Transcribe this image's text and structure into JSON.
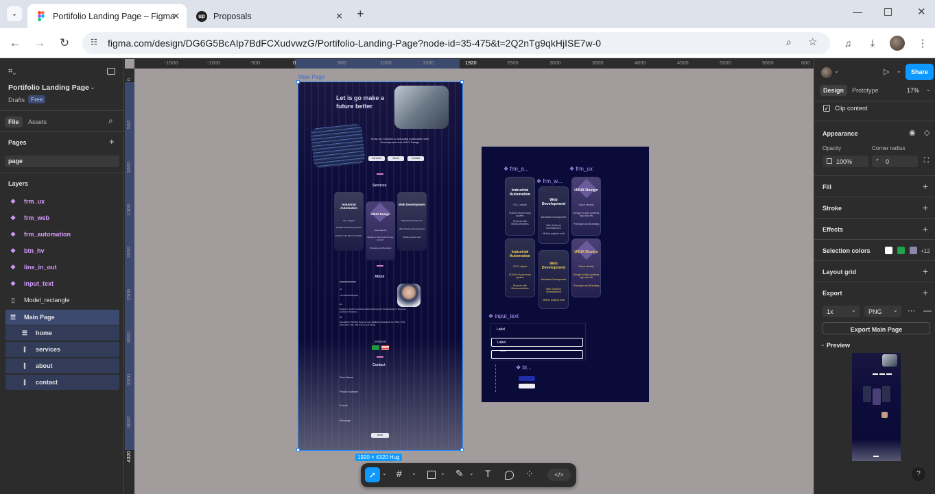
{
  "browser": {
    "tabs": [
      {
        "title": "Portifolio Landing Page – Figma",
        "active": true
      },
      {
        "title": "Proposals",
        "active": false
      }
    ],
    "url": "figma.com/design/DG6G5BcAIp7BdFCXudvwzG/Portifolio-Landing-Page?node-id=35-475&t=2Q2nTg9qkHjISE7w-0"
  },
  "left_panel": {
    "file_name": "Portifolio Landing Page",
    "drafts": "Drafts",
    "plan_badge": "Free",
    "tab_file": "File",
    "tab_assets": "Assets",
    "pages_title": "Pages",
    "current_page": "page",
    "layers_title": "Layers",
    "layers": [
      {
        "name": "frm_ux",
        "kind": "component"
      },
      {
        "name": "frm_web",
        "kind": "component"
      },
      {
        "name": "frm_automation",
        "kind": "component"
      },
      {
        "name": "btn_hv",
        "kind": "component"
      },
      {
        "name": "line_in_out",
        "kind": "component"
      },
      {
        "name": "input_text",
        "kind": "component"
      },
      {
        "name": "Model_rectangle",
        "kind": "rectangle"
      },
      {
        "name": "Main Page",
        "kind": "frame",
        "selected": true
      }
    ],
    "sublayers": [
      "home",
      "services",
      "about",
      "contact"
    ]
  },
  "canvas": {
    "ruler_top": [
      "-1500",
      "-1000",
      "-500",
      "0",
      "500",
      "1000",
      "1500",
      "1920",
      "2500",
      "3000",
      "3500",
      "4000",
      "4500",
      "5000",
      "5500",
      "600"
    ],
    "ruler_left": [
      "0",
      "500",
      "1000",
      "1500",
      "2000",
      "2500",
      "3000",
      "3500",
      "4000",
      "4320"
    ],
    "frame_label": "Main Page",
    "frame_size_badge": "1920 × 4320 Hug",
    "main_frame": {
      "hero_title": "Let is go make a future better",
      "hero_sub": "Know our services to Industrial Automation Web Development and UI/UX Design",
      "buttons": [
        "Services",
        "About",
        "Contact"
      ],
      "services_title": "Services",
      "about_title": "About",
      "contact_title": "Contact",
      "service_cards": [
        {
          "title": "Industrial Automation",
          "lines": [
            "PLC Ladyial",
            "SCADA Supervisory system",
            "Projects with Microcontrollers"
          ]
        },
        {
          "title": "UI/UX Design",
          "lines": [
            "Visual Identity",
            "Design to sites systems logo and etc",
            "Prototype and Branding"
          ]
        },
        {
          "title": "Web Development",
          "lines": [
            "Websites Development",
            "Web Systems Development",
            "Mobile projects web"
          ]
        }
      ],
      "about_lines": [
        "01",
        "I am Renato Bogota",
        "02",
        "Degree in Control and Automation Engineering Postgraduate in the same academic discipline",
        "03",
        "Specialist in SCADA Systems and qualified professional for HTML, CSS, Javascript, SQL, DB, Canva and Figma"
      ],
      "speaker_label": "SPEAKER",
      "contact_fields": [
        "Sum Name",
        "Phone Number",
        "E-mail",
        "Message"
      ],
      "send_label": "Send"
    },
    "components_frame": {
      "labels": {
        "frm_a": "frm_a...",
        "frm_w": "frm_w...",
        "frm_ux": "frm_ux",
        "input_text": "input_text",
        "bt": "bt..."
      },
      "cards_row1": [
        {
          "title": "Industrial Automation",
          "lines": [
            "PLC Ladyial",
            "SCADA Supervisory system",
            "Projects with Microcontrollers"
          ]
        },
        {
          "title": "Web Development",
          "lines": [
            "Websites Development",
            "Web Systems Development",
            "Mobile projects web"
          ]
        },
        {
          "title": "UI/UX Design",
          "lines": [
            "Visual Identity",
            "Design to sites systems logo and etc",
            "Prototype and Branding"
          ]
        }
      ],
      "cards_row2": [
        {
          "title": "Industrial Automation",
          "lines": [
            "PLC Ladyial",
            "SCADA Supervisory system",
            "Projects with Microcontrollers"
          ]
        },
        {
          "title": "Web Development",
          "lines": [
            "Websites Development",
            "Web Systems Development",
            "Mobile projects web"
          ]
        },
        {
          "title": "UI/UX Design",
          "lines": [
            "Visual Identity",
            "Design to sites systems logo and etc",
            "Prototype and Branding"
          ]
        }
      ],
      "input_labels": [
        "Label",
        "Label",
        "Label"
      ],
      "btn_labels": [
        "Label",
        "Label"
      ]
    }
  },
  "toolbar": {
    "tools": [
      "move-tool",
      "frame-tool",
      "shape-tool",
      "pen-tool",
      "text-tool",
      "comment-tool",
      "actions-tool",
      "dev-mode-toggle"
    ]
  },
  "right_panel": {
    "share": "Share",
    "tab_design": "Design",
    "tab_prototype": "Prototype",
    "zoom": "17%",
    "clip_content": "Clip content",
    "appearance": "Appearance",
    "opacity_label": "Opacity",
    "opacity_value": "100%",
    "radius_label": "Corner radius",
    "radius_value": "0",
    "fill": "Fill",
    "stroke": "Stroke",
    "effects": "Effects",
    "selection_colors": "Selection colors",
    "selection_colors_more": "+12",
    "swatches": [
      "#ffffff",
      "#1fa34a",
      "#8a8aa8"
    ],
    "layout_grid": "Layout grid",
    "export": "Export",
    "export_scale": "1x",
    "export_format": "PNG",
    "export_button": "Export Main Page",
    "preview": "Preview",
    "help": "?"
  },
  "colors": {
    "accent": "#0d99ff",
    "component": "#d59bff",
    "canvas": "#a29c9d"
  }
}
